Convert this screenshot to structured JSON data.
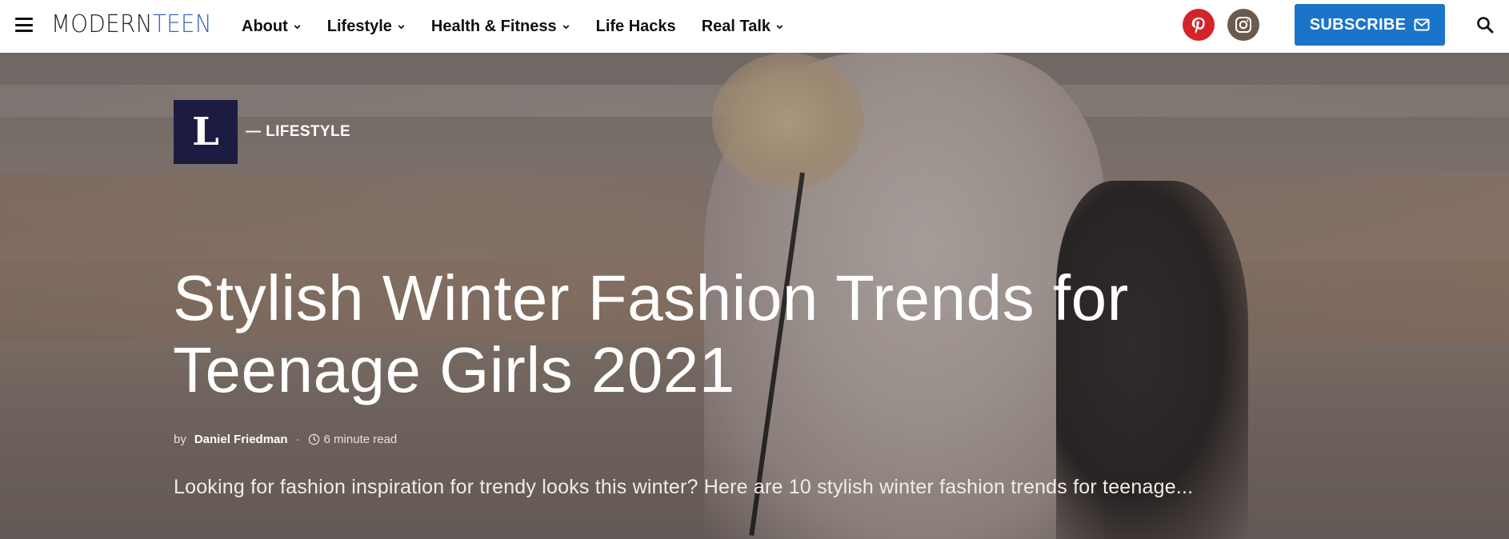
{
  "nav": {
    "logo_bold": "MODERN",
    "logo_colored": "TEEN",
    "menu": [
      {
        "label": "About",
        "has_dropdown": true
      },
      {
        "label": "Lifestyle",
        "has_dropdown": true
      },
      {
        "label": "Health & Fitness",
        "has_dropdown": true
      },
      {
        "label": "Life Hacks",
        "has_dropdown": false
      },
      {
        "label": "Real Talk",
        "has_dropdown": true
      }
    ],
    "subscribe_label": "SUBSCRIBE",
    "icons": [
      "menu-icon",
      "pinterest-icon",
      "instagram-icon",
      "mail-icon",
      "search-icon"
    ]
  },
  "hero": {
    "category_letter": "L",
    "category_label": "— LIFESTYLE",
    "title": "Stylish Winter Fashion Trends for Teenage Girls 2021",
    "by": "by",
    "author": "Daniel Friedman",
    "separator": "·",
    "read_time": "6 minute read",
    "excerpt": "Looking for fashion inspiration for trendy looks this winter? Here are 10 stylish winter fashion trends for teenage..."
  },
  "colors": {
    "accent": "#1a74c9",
    "category_badge": "#1c1c42",
    "pinterest": "#d3242c",
    "instagram": "#6b5b4f",
    "logo_accent": "#3a67b8"
  }
}
